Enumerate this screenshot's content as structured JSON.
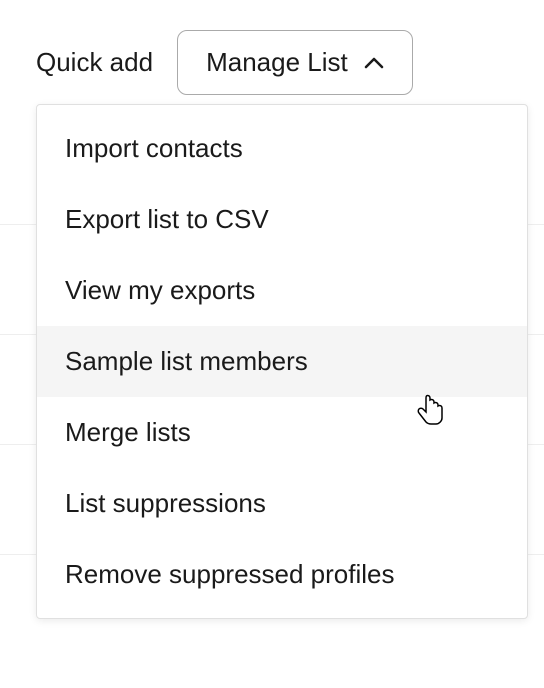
{
  "toolbar": {
    "quick_add_label": "Quick add",
    "manage_list_label": "Manage List"
  },
  "dropdown": {
    "items": [
      {
        "label": "Import contacts",
        "hovered": false
      },
      {
        "label": "Export list to CSV",
        "hovered": false
      },
      {
        "label": "View my exports",
        "hovered": false
      },
      {
        "label": "Sample list members",
        "hovered": true
      },
      {
        "label": "Merge lists",
        "hovered": false
      },
      {
        "label": "List suppressions",
        "hovered": false
      },
      {
        "label": "Remove suppressed profiles",
        "hovered": false
      }
    ]
  }
}
